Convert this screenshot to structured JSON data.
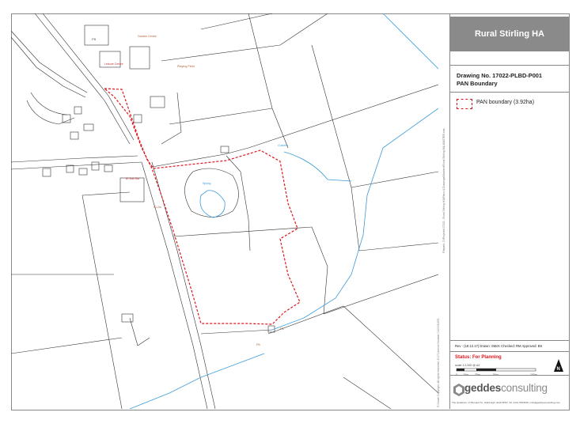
{
  "title_block": {
    "client": "Rural Stirling HA",
    "drawing_no": "Drawing No. 17022-PLBD-P001",
    "drawing_title": "PAN Boundary",
    "legend": [
      {
        "label": "PAN boundary (3.92ha)",
        "style": "red-dashed-rectangle",
        "color": "#e0141b"
      }
    ],
    "revision": "Rev - (19.12.17) Drawn: SMcK    Checked: RM    Approved: BS",
    "status": "Status: For Planning",
    "scale": "scale 1:2,000 @ A3",
    "scale_ticks": [
      "0",
      "10m",
      "25m",
      "50m",
      "100m"
    ],
    "north_label": "N",
    "logo_bold": "geddes",
    "logo_light": "consulting",
    "address": "The Quadrant, 17 Bernard St., Edinburgh, EH6 6PW  |  Tel: 0131 5534636  |  info@geddesconsulting.com"
  },
  "map": {
    "labels": {
      "fb_top": "FB",
      "garden_centre": "Garden Centre",
      "leisure_centre": "Leisure Centre",
      "playing_field": "Playing Field",
      "el_sub_sta": "El Sub Sta",
      "level": "91.2m",
      "pond": "Spring",
      "culverts": "Culverts",
      "fb_bottom": "FB",
      "fb_bottom2": "FB"
    },
    "copyright": "© Crown Copyright. All rights reserved. 2017 Licence Number 0100031673",
    "filepath": "Filepath: Z:\\Projects\\17022 - Rural Stirling HA\\Plans & Drawings\\Masters\\Rural Stirling MA-MASTER.vwx",
    "colors": {
      "boundary": "#e0141b",
      "water": "#3a9bd9",
      "lines": "#333333"
    }
  }
}
